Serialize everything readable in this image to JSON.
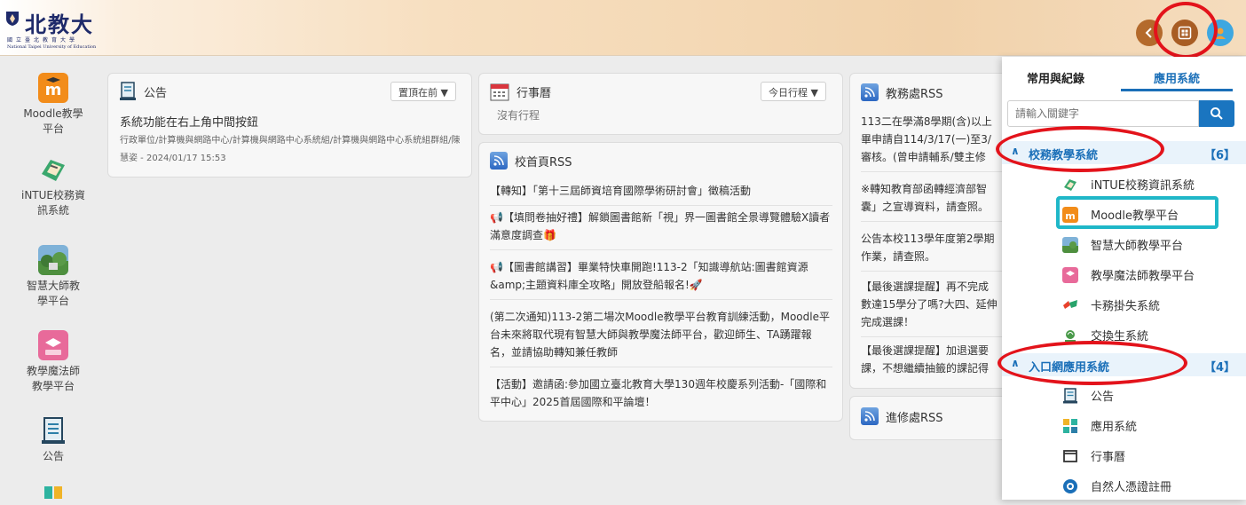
{
  "header": {
    "logo_title": "北教大",
    "logo_sub": "國立臺北教育大學",
    "logo_en": "National Taipei University of Education"
  },
  "sidebar": {
    "items": [
      {
        "label": "Moodle教學\n平台",
        "icon": "moodle-icon",
        "color": "#f28c1a"
      },
      {
        "label": "iNTUE校務資\n訊系統",
        "icon": "intue-icon",
        "color": "#3aa76d"
      },
      {
        "label": "智慧大師教\n學平台",
        "icon": "smart-master-icon",
        "color": "#5a9a5a"
      },
      {
        "label": "教學魔法師\n教學平台",
        "icon": "teaching-magic-icon",
        "color": "#e86a9a"
      },
      {
        "label": "公告",
        "icon": "announcement-icon",
        "color": "#2c7fa8"
      }
    ]
  },
  "announcement_card": {
    "title": "公告",
    "dropdown": "置頂在前",
    "item_title": "系統功能在右上角中間按鈕",
    "item_meta": "行政單位/計算機與網路中心/計算機與網路中心系統組/計算機與網路中心系統組群組/陳慧姿 - 2024/01/17 15:53"
  },
  "calendar_card": {
    "title": "行事曆",
    "dropdown": "今日行程",
    "empty": "沒有行程"
  },
  "homepage_rss": {
    "title": "校首頁RSS",
    "items": [
      "【轉知】「第十三屆師資培育國際學術研討會」徵稿活動",
      "📢【填問卷抽好禮】解鎖圖書館新「視」界一圖書館全景導覽體驗X讀者滿意度調查🎁",
      "📢【圖書館講習】畢業特快車開跑!113-2「知識導航站:圖書館資源&amp;主題資料庫全攻略」開放登船報名!🚀",
      "(第二次通知)113-2第二場次Moodle教學平台教育訓練活動，Moodle平台未來將取代現有智慧大師與教學魔法師平台，歡迎師生、TA踴躍報名，並請協助轉知兼任教師",
      "【活動】邀請函:參加國立臺北教育大學130週年校慶系列活動-「國際和平中心」2025首屆國際和平論壇！"
    ]
  },
  "academic_rss": {
    "title": "教務處RSS",
    "items": [
      "113二在學滿8學期(含)以上\n畢申請自114/3/17(一)至3/\n審核。(曾申請輔系/雙主修",
      "※轉知教育部函轉經濟部智\n囊」之宣導資料，請查照。",
      "公告本校113學年度第2學期\n作業，請查照。",
      "【最後選課提醒】再不完成\n數達15學分了嗎?大四、延伸\n完成選課！",
      "【最後選課提醒】加退選要\n課，不想繼續抽籤的課記得"
    ]
  },
  "extension_rss": {
    "title": "進修處RSS"
  },
  "panel": {
    "tab_frequent": "常用與紀錄",
    "tab_apps": "應用系統",
    "search_placeholder": "請輸入關鍵字",
    "group1": {
      "label": "校務教學系統",
      "count": "【6】"
    },
    "group1_items": [
      {
        "label": "iNTUE校務資訊系統",
        "icon": "intue-icon",
        "color": "#3aa76d"
      },
      {
        "label": "Moodle教學平台",
        "icon": "moodle-icon",
        "color": "#f28c1a"
      },
      {
        "label": "智慧大師教學平台",
        "icon": "smart-master-icon",
        "color": "#5a9a5a"
      },
      {
        "label": "教學魔法師教學平台",
        "icon": "teaching-magic-icon",
        "color": "#e86a9a"
      },
      {
        "label": "卡務掛失系統",
        "icon": "card-icon",
        "color": "#27a36b"
      },
      {
        "label": "交換生系統",
        "icon": "exchange-icon",
        "color": "#4a9a4a"
      }
    ],
    "group2": {
      "label": "入口網應用系統",
      "count": "【4】"
    },
    "group2_items": [
      {
        "label": "公告",
        "icon": "announcement-icon",
        "color": "#2c7fa8"
      },
      {
        "label": "應用系統",
        "icon": "apps-icon",
        "color": "#e6a020"
      },
      {
        "label": "行事曆",
        "icon": "calendar-icon",
        "color": "#333333"
      },
      {
        "label": "自然人憑證註冊",
        "icon": "certificate-icon",
        "color": "#1a6fb8"
      }
    ]
  },
  "colors": {
    "accent": "#1a6fb8",
    "highlight_red": "#e3131b",
    "highlight_teal": "#1fb7c8"
  }
}
